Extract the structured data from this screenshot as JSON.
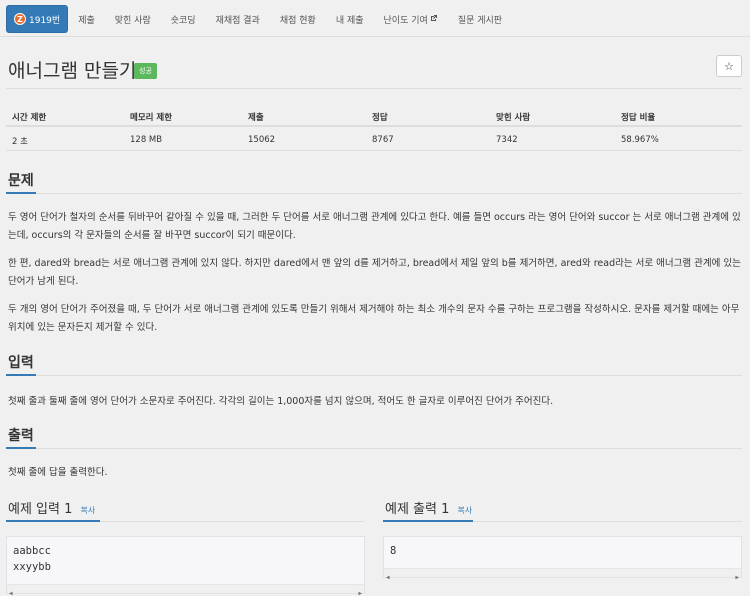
{
  "tabs": {
    "problem_number": "1919번",
    "tier_icon_letter": "Z",
    "items": [
      "제출",
      "맞힌 사람",
      "숏코딩",
      "재채점 결과",
      "채점 현황",
      "내 제출",
      "난이도 기여",
      "질문 게시판"
    ]
  },
  "problem": {
    "title": "애너그램 만들기",
    "status_badge": "성공",
    "star": "☆"
  },
  "info": {
    "headers": [
      "시간 제한",
      "메모리 제한",
      "제출",
      "정답",
      "맞힌 사람",
      "정답 비율"
    ],
    "values": [
      "2 초",
      "128 MB",
      "15062",
      "8767",
      "7342",
      "58.967%"
    ]
  },
  "sections": {
    "description_title": "문제",
    "description": [
      "두 영어 단어가 철자의 순서를 뒤바꾸어 같아질 수 있을 때, 그러한 두 단어를 서로 애너그램 관계에 있다고 한다. 예를 들면 occurs 라는 영어 단어와 succor 는 서로 애너그램 관계에 있는데, occurs의 각 문자들의 순서를 잘 바꾸면 succor이 되기 때문이다.",
      "한 편, dared와 bread는 서로 애너그램 관계에 있지 않다. 하지만 dared에서 맨 앞의 d를 제거하고, bread에서 제일 앞의 b를 제거하면, ared와 read라는 서로 애너그램 관계에 있는 단어가 남게 된다.",
      "두 개의 영어 단어가 주어졌을 때, 두 단어가 서로 애너그램 관계에 있도록 만들기 위해서 제거해야 하는 최소 개수의 문자 수를 구하는 프로그램을 작성하시오. 문자를 제거할 때에는 아무 위치에 있는 문자든지 제거할 수 있다."
    ],
    "input_title": "입력",
    "input_text": "첫째 줄과 둘째 줄에 영어 단어가 소문자로 주어진다. 각각의 길이는 1,000자를 넘지 않으며, 적어도 한 글자로 이루어진 단어가 주어진다.",
    "output_title": "출력",
    "output_text": "첫째 줄에 답을 출력한다."
  },
  "samples": {
    "input_label": "예제 입력",
    "input_number": "1",
    "output_label": "예제 출력",
    "output_number": "1",
    "copy_label": "복사",
    "input_lines": [
      "aabbcc",
      "xxyybb"
    ],
    "output_lines": [
      "8"
    ]
  },
  "colors": {
    "accent": "#337ab7",
    "success": "#5cb85c",
    "tier": "#e36b2c"
  }
}
